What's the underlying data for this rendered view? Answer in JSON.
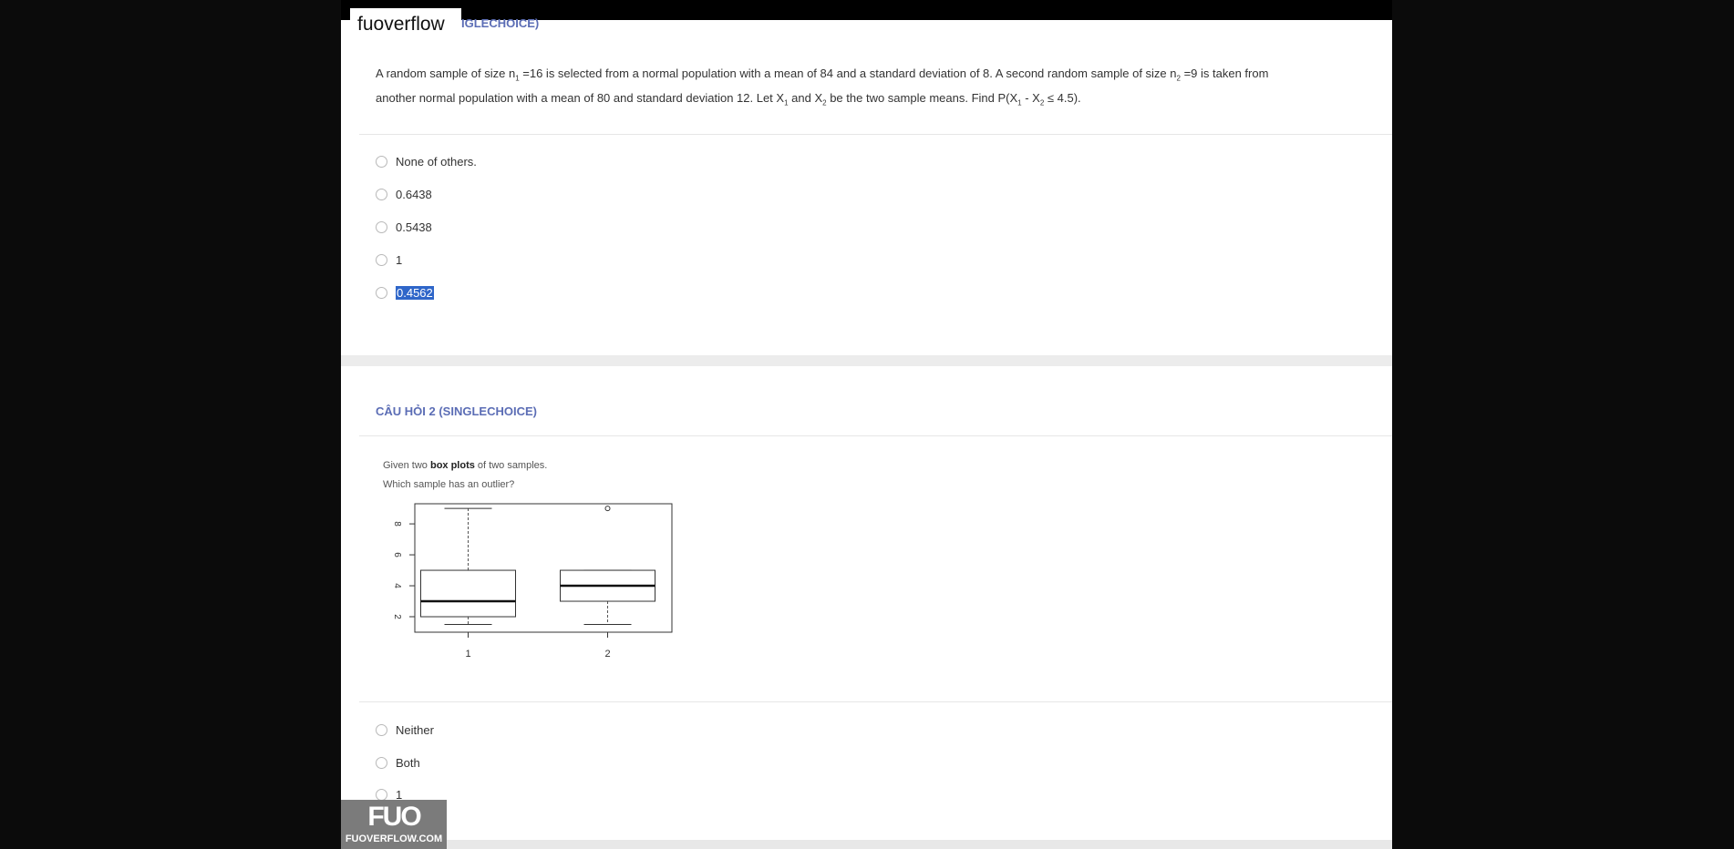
{
  "site": {
    "name": "fuoverflow",
    "logo_mark": "FUO",
    "logo_text": "FUOVERFLOW.COM"
  },
  "question1": {
    "header_fragment": "IGLECHOICE)",
    "text_parts": {
      "a": "A random sample of size n",
      "b": " =16 is selected from a normal population with a mean of 84 and a standard deviation of 8. A second random sample of size n",
      "c": " =9 is taken from",
      "d": "another normal population with a mean of 80 and standard deviation 12. Let X",
      "e": " and X",
      "f": " be the two sample means. Find P(X",
      "g": " - X",
      "h": " ≤ 4.5).",
      "sub1": "1",
      "sub2": "2"
    },
    "options": [
      "None of others.",
      "0.6438",
      "0.5438",
      "1",
      "0.4562"
    ],
    "selected_option": "0.4562"
  },
  "question2": {
    "header": "CÂU HỎI 2 (SINGLECHOICE)",
    "intro_a": "Given two ",
    "intro_bold": "box plots",
    "intro_b": " of two samples.",
    "intro_2": "Which sample has an outlier?",
    "options": [
      "Neither",
      "Both",
      "1"
    ]
  },
  "chart_data": {
    "type": "box",
    "categories": [
      "1",
      "2"
    ],
    "y_ticks": [
      "2",
      "4",
      "6",
      "8"
    ],
    "ylim": [
      1,
      9.3
    ],
    "boxes": [
      {
        "name": "1",
        "min": 1.5,
        "q1": 2,
        "median": 3,
        "q3": 5,
        "max": 9,
        "outliers": []
      },
      {
        "name": "2",
        "min": 1.5,
        "q1": 3,
        "median": 4,
        "q3": 5,
        "max": 5,
        "outliers": [
          9
        ]
      }
    ]
  }
}
